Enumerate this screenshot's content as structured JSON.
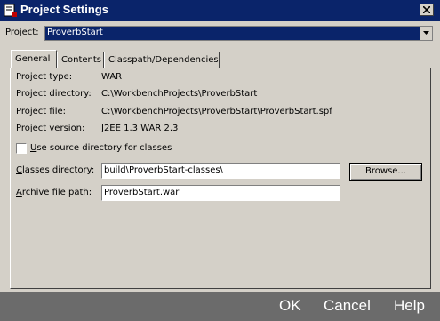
{
  "window": {
    "title": "Project Settings"
  },
  "project": {
    "label": "Project:",
    "value": "ProverbStart"
  },
  "tabs": [
    {
      "label": "General"
    },
    {
      "label": "Contents"
    },
    {
      "label": "Classpath/Dependencies"
    }
  ],
  "info": [
    {
      "label": "Project type:",
      "value": "WAR"
    },
    {
      "label": "Project directory:",
      "value": "C:\\WorkbenchProjects\\ProverbStart"
    },
    {
      "label": "Project file:",
      "value": "C:\\WorkbenchProjects\\ProverbStart\\ProverbStart.spf"
    },
    {
      "label": "Project version:",
      "value": "J2EE 1.3 WAR 2.3"
    }
  ],
  "checkbox": {
    "label_u": "U",
    "label_rest": "se source directory for classes"
  },
  "classes_dir": {
    "label_u": "C",
    "label_rest": "lasses directory:",
    "value": "build\\ProverbStart-classes\\"
  },
  "archive": {
    "label_u": "A",
    "label_rest": "rchive file path:",
    "value": "ProverbStart.war"
  },
  "browse": {
    "label": "Browse..."
  },
  "footer": {
    "ok": "OK",
    "cancel": "Cancel",
    "help": "Help"
  }
}
